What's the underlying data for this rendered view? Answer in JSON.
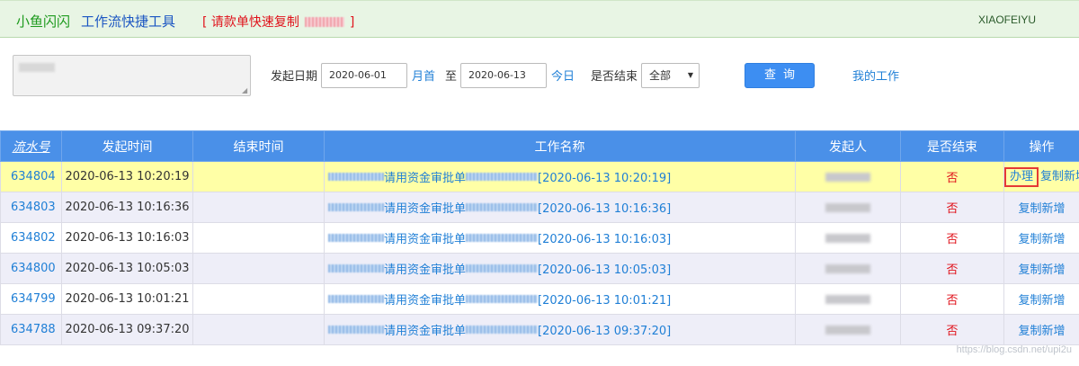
{
  "header": {
    "brand": "小鱼闪闪",
    "app_name": "工作流快捷工具",
    "promo_left": "[ 请款单快速复制",
    "promo_right": "]",
    "user": "XIAOFEIYU"
  },
  "filters": {
    "start_date_label": "发起日期",
    "start_date": "2020-06-01",
    "month_start_link": "月首",
    "to_label": "至",
    "end_date": "2020-06-13",
    "today_link": "今日",
    "finished_label": "是否结束",
    "finished_value": "全部",
    "query_button": "查询",
    "my_work_link": "我的工作"
  },
  "table": {
    "columns": [
      "流水号",
      "发起时间",
      "结束时间",
      "工作名称",
      "发起人",
      "是否结束",
      "操作"
    ],
    "rows": [
      {
        "id": "634804",
        "start": "2020-06-13 10:20:19",
        "end": "",
        "name": "请用资金审批单",
        "stamp": "[2020-06-13 10:20:19]",
        "finished": "否",
        "op_handle": "办理",
        "op_copy": "复制新增"
      },
      {
        "id": "634803",
        "start": "2020-06-13 10:16:36",
        "end": "",
        "name": "请用资金审批单",
        "stamp": "[2020-06-13 10:16:36]",
        "finished": "否",
        "op_copy": "复制新增"
      },
      {
        "id": "634802",
        "start": "2020-06-13 10:16:03",
        "end": "",
        "name": "请用资金审批单",
        "stamp": "[2020-06-13 10:16:03]",
        "finished": "否",
        "op_copy": "复制新增"
      },
      {
        "id": "634800",
        "start": "2020-06-13 10:05:03",
        "end": "",
        "name": "请用资金审批单",
        "stamp": "[2020-06-13 10:05:03]",
        "finished": "否",
        "op_copy": "复制新增"
      },
      {
        "id": "634799",
        "start": "2020-06-13 10:01:21",
        "end": "",
        "name": "请用资金审批单",
        "stamp": "[2020-06-13 10:01:21]",
        "finished": "否",
        "op_copy": "复制新增"
      },
      {
        "id": "634788",
        "start": "2020-06-13 09:37:20",
        "end": "",
        "name": "请用资金审批单",
        "stamp": "[2020-06-13 09:37:20]",
        "finished": "否",
        "op_copy": "复制新增"
      }
    ]
  },
  "watermark": "https://blog.csdn.net/upi2u",
  "colors": {
    "header_bg": "#e8f5e4",
    "table_header": "#4a90e8",
    "highlight_row": "#ffffa6",
    "alt_row": "#eeeef8",
    "link": "#1f7fd6",
    "no_red": "#e0121b",
    "query_button": "#3d8ef2"
  }
}
